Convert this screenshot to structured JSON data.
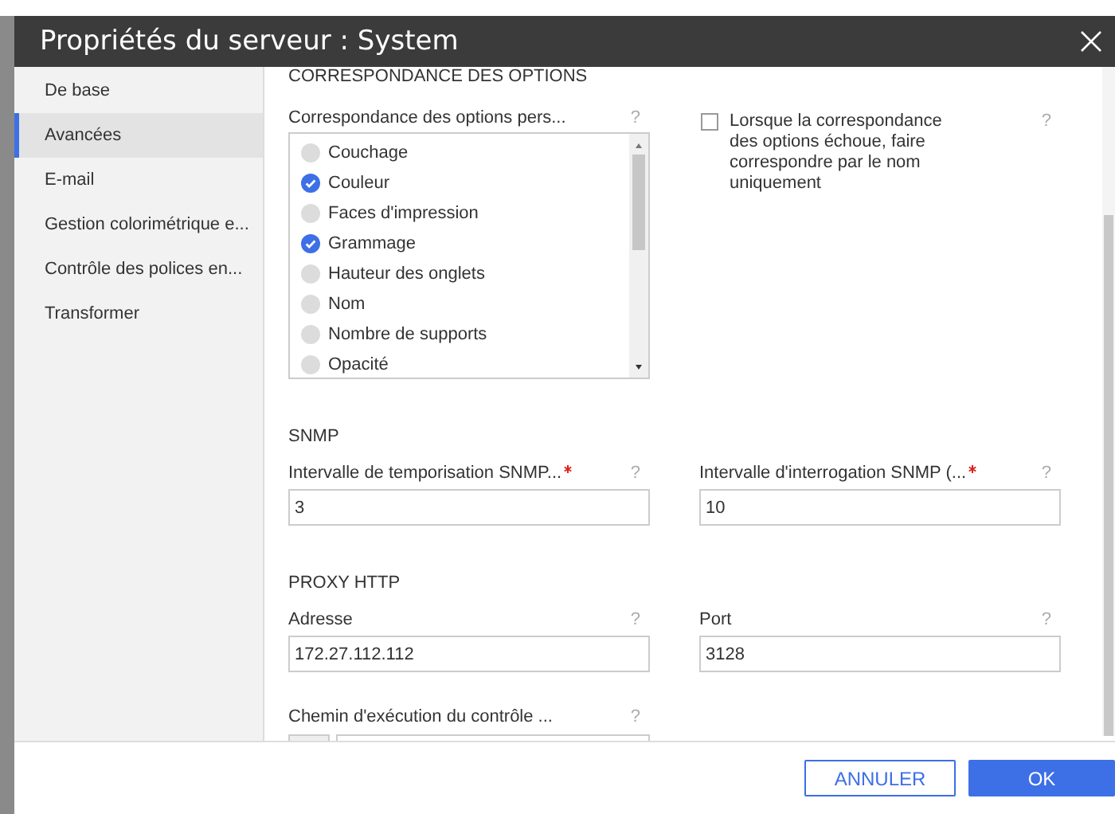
{
  "window": {
    "title": "Propriétés du serveur : System"
  },
  "sidebar": {
    "items": [
      {
        "label": "De base",
        "selected": false
      },
      {
        "label": "Avancées",
        "selected": true
      },
      {
        "label": "E-mail",
        "selected": false
      },
      {
        "label": "Gestion colorimétrique e...",
        "selected": false
      },
      {
        "label": "Contrôle des polices en...",
        "selected": false
      },
      {
        "label": "Transformer",
        "selected": false
      }
    ]
  },
  "option_mapping": {
    "heading": "CORRESPONDANCE DES OPTIONS",
    "list_label": "Correspondance des options pers...",
    "help": "?",
    "options": [
      {
        "label": "Couchage",
        "checked": false
      },
      {
        "label": "Couleur",
        "checked": true
      },
      {
        "label": "Faces d'impression",
        "checked": false
      },
      {
        "label": "Grammage",
        "checked": true
      },
      {
        "label": "Hauteur des onglets",
        "checked": false
      },
      {
        "label": "Nom",
        "checked": false
      },
      {
        "label": "Nombre de supports",
        "checked": false
      },
      {
        "label": "Opacité",
        "checked": false
      }
    ],
    "fallback": {
      "label": "Lorsque la correspondance des options échoue, faire correspondre par le nom uniquement",
      "checked": false,
      "help": "?"
    }
  },
  "sections": [
    {
      "heading": "SNMP",
      "fields": [
        {
          "kind": "text",
          "label": "Intervalle de temporisation SNMP...",
          "required": true,
          "help": "?",
          "value": "3"
        },
        {
          "kind": "text",
          "label": "Intervalle d'interrogation SNMP (...",
          "required": true,
          "help": "?",
          "value": "10"
        }
      ]
    },
    {
      "heading": "PROXY HTTP",
      "fields": [
        {
          "kind": "text",
          "label": "Adresse",
          "required": false,
          "help": "?",
          "value": "172.27.112.112"
        },
        {
          "kind": "text",
          "label": "Port",
          "required": false,
          "help": "?",
          "value": "3128"
        }
      ]
    },
    {
      "fields": [
        {
          "kind": "browse",
          "label": "Chemin d'exécution du contrôle ...",
          "required": false,
          "help": "?"
        }
      ]
    }
  ],
  "buttons": [
    {
      "label": "ANNULER",
      "kind": "secondary"
    },
    {
      "label": "OK",
      "kind": "primary"
    }
  ]
}
